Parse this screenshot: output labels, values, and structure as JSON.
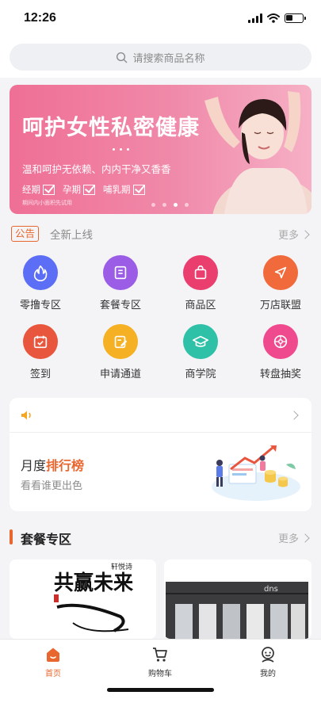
{
  "status_bar": {
    "time": "12:26"
  },
  "search": {
    "placeholder": "请搜索商品名称"
  },
  "banner": {
    "title": "呵护女性私密健康",
    "subtitle": "温和呵护无依赖、内内干净又香香",
    "checks": [
      "经期",
      "孕期",
      "哺乳期"
    ],
    "small_text": "期间内小面积先试用",
    "page_count": 4,
    "active_page": 2
  },
  "notice": {
    "tag": "公告",
    "text": "全新上线",
    "more": "更多"
  },
  "grid": [
    {
      "label": "零撸专区",
      "icon": "flame-icon",
      "color": "#5b6ef5"
    },
    {
      "label": "套餐专区",
      "icon": "package-icon",
      "color": "#9b5de5"
    },
    {
      "label": "商品区",
      "icon": "bag-icon",
      "color": "#ea3e6e"
    },
    {
      "label": "万店联盟",
      "icon": "navigation-icon",
      "color": "#f06a3c"
    },
    {
      "label": "签到",
      "icon": "calendar-check-icon",
      "color": "#e8563d"
    },
    {
      "label": "申请通道",
      "icon": "edit-icon",
      "color": "#f5b024"
    },
    {
      "label": "商学院",
      "icon": "graduation-cap-icon",
      "color": "#2fc1a8"
    },
    {
      "label": "转盘抽奖",
      "icon": "wheel-icon",
      "color": "#f04a8e"
    }
  ],
  "rank": {
    "title_prefix": "月度",
    "title_highlight": "排行榜",
    "subtitle": "看看谁更出色"
  },
  "section": {
    "title": "套餐专区",
    "more": "更多"
  },
  "products": [
    {
      "calligraphy_small": "轩悦诗",
      "calligraphy_big": "共赢未来"
    },
    {
      "store_sign": "dns"
    }
  ],
  "tabbar": [
    {
      "label": "首页",
      "icon": "home-icon",
      "active": true
    },
    {
      "label": "购物车",
      "icon": "cart-icon",
      "active": false
    },
    {
      "label": "我的",
      "icon": "user-icon",
      "active": false
    }
  ],
  "colors": {
    "accent": "#e8672f",
    "banner_pink": "#ef6f95"
  }
}
